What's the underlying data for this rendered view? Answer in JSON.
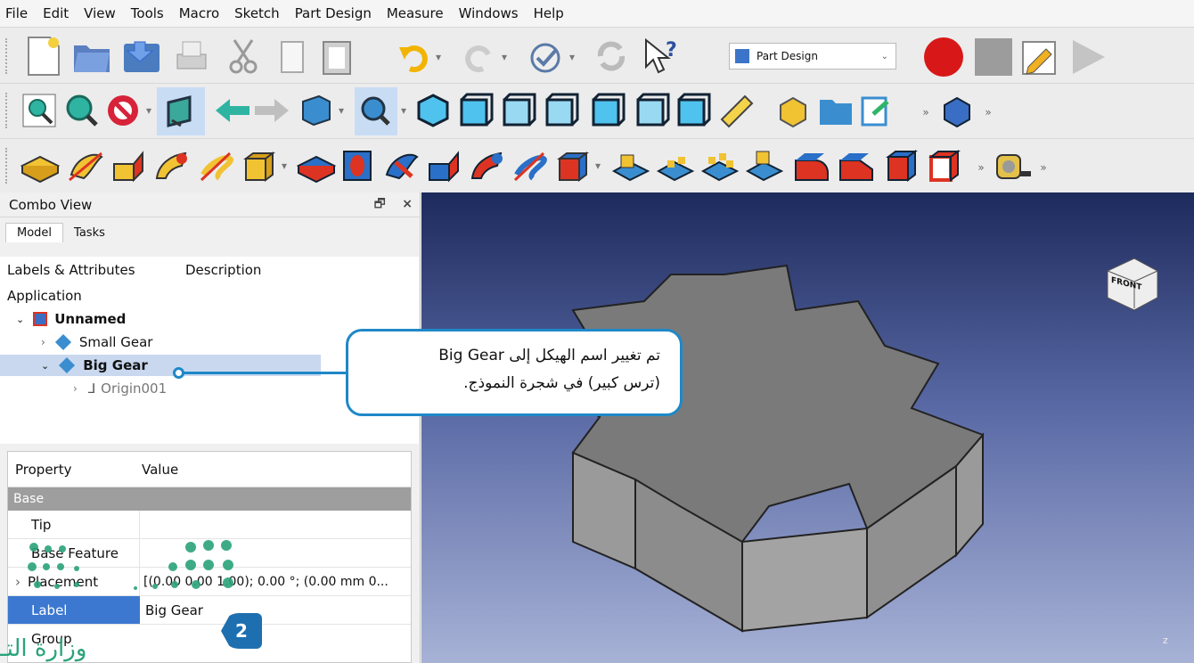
{
  "menu": [
    "File",
    "Edit",
    "View",
    "Tools",
    "Macro",
    "Sketch",
    "Part Design",
    "Measure",
    "Windows",
    "Help"
  ],
  "workbench_selector": {
    "value": "Part Design"
  },
  "toolbar_overflow": "»",
  "combo_view": {
    "title": "Combo View",
    "float_glyph": "🗗",
    "close_glyph": "×",
    "tabs": [
      "Model",
      "Tasks"
    ],
    "tree_headers": [
      "Labels & Attributes",
      "Description"
    ],
    "application_label": "Application",
    "tree": [
      {
        "label": "Unnamed",
        "bold": true
      },
      {
        "label": "Small Gear",
        "bold": false
      },
      {
        "label": "Big Gear",
        "bold": true,
        "selected": true
      },
      {
        "label": "Origin001",
        "bold": false
      }
    ]
  },
  "properties": {
    "headers": [
      "Property",
      "Value"
    ],
    "group": "Base",
    "rows": [
      {
        "name": "Tip",
        "value": ""
      },
      {
        "name": "Base Feature",
        "value": ""
      },
      {
        "name": "Placement",
        "value": "[(0.00 0.00 1.00); 0.00 °; (0.00 mm  0..."
      },
      {
        "name": "Label",
        "value": "Big Gear",
        "selected": true
      },
      {
        "name": "Group",
        "value": ""
      }
    ]
  },
  "callout": {
    "line1": "تم تغيير اسم الهيكل إلى Big Gear",
    "line2": "(ترس كبير) في شجرة النموذج."
  },
  "step_badge": "2",
  "watermark": "وزارة التـ",
  "navcube": {
    "face_label": "FRONT"
  },
  "axis_label": "z",
  "colors": {
    "accent": "#1e88c8",
    "selection": "#c9d8ee",
    "viewport_top": "#1d2a5c",
    "viewport_bottom": "#a7b2d6",
    "gear": "#8a8a8a"
  }
}
